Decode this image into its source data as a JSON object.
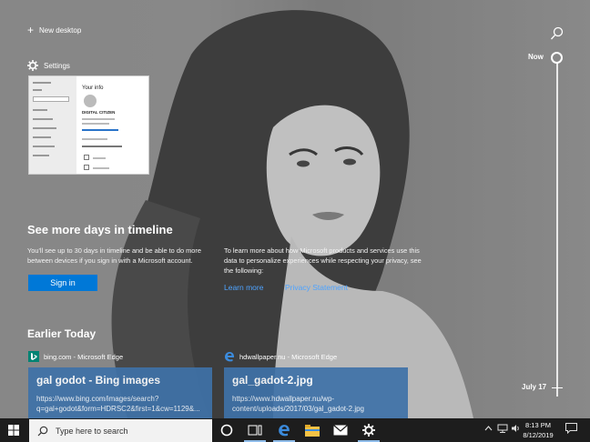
{
  "top": {
    "new_desktop_label": "New desktop"
  },
  "timeline": {
    "now_label": "Now",
    "date_label": "July 17"
  },
  "settings_window": {
    "title": "Settings",
    "thumb_heading": "Your info",
    "thumb_subheading": "DIGITAL CITIZEN"
  },
  "promo": {
    "title": "See more days in timeline",
    "text": "You'll see up to 30 days in timeline and be able to do more between devices if you sign in with a Microsoft account.",
    "signin_label": "Sign in",
    "privacy_text": "To learn more about how Microsoft products and services use this data to personalize experiences while respecting your privacy, see the following:",
    "learn_more_label": "Learn more",
    "privacy_statement_label": "Privacy Statement"
  },
  "earlier_today": {
    "heading": "Earlier Today",
    "cards": [
      {
        "source": "bing.com - Microsoft Edge",
        "title": "gal godot - Bing images",
        "url": "https://www.bing.com/images/search?q=gal+godot&form=HDRSC2&first=1&cw=1129&..."
      },
      {
        "source": "hdwallpaper.nu - Microsoft Edge",
        "title": "gal_gadot-2.jpg",
        "url": "https://www.hdwallpaper.nu/wp-content/uploads/2017/03/gal_gadot-2.jpg"
      }
    ]
  },
  "taskbar": {
    "search_placeholder": "Type here to search",
    "time": "8:13 PM",
    "date": "8/12/2019",
    "accent": "#0078d7"
  }
}
